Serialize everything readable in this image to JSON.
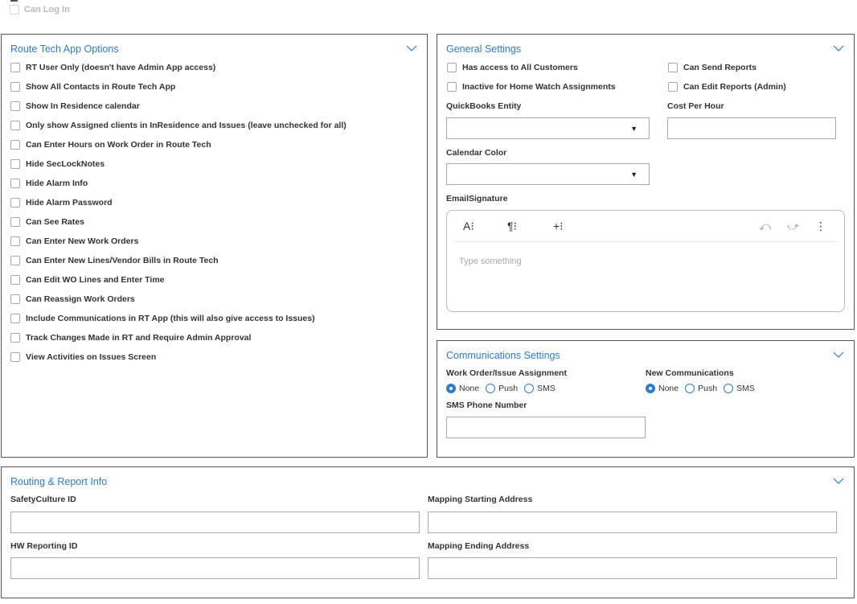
{
  "top": {
    "can_log_in": "Can Log In"
  },
  "route_tech": {
    "title": "Route Tech App Options",
    "options": [
      "RT User Only (doesn't have Admin App access)",
      "Show All Contacts in Route Tech App",
      "Show In Residence calendar",
      "Only show Assigned clients in InResidence and Issues (leave unchecked for all)",
      "Can Enter Hours on Work Order in Route Tech",
      "Hide SecLockNotes",
      "Hide Alarm Info",
      "Hide Alarm Password",
      "Can See Rates",
      "Can Enter New Work Orders",
      "Can Enter New Lines/Vendor Bills in Route Tech",
      "Can Edit WO Lines and Enter Time",
      "Can Reassign Work Orders",
      "Include Communications in RT App (this will also give access to Issues)",
      "Track Changes Made in RT and Require Admin Approval",
      "View Activities on Issues Screen"
    ]
  },
  "general": {
    "title": "General Settings",
    "has_access_all_customers": "Has access to All Customers",
    "inactive_home_watch": "Inactive for Home Watch Assignments",
    "can_send_reports": "Can Send Reports",
    "can_edit_reports": "Can Edit Reports (Admin)",
    "quickbooks_label": "QuickBooks Entity",
    "quickbooks_value": "",
    "cost_per_hour_label": "Cost Per Hour",
    "cost_per_hour_value": "",
    "calendar_color_label": "Calendar Color",
    "calendar_color_value": "",
    "email_signature_label": "EmailSignature",
    "editor": {
      "font_btn": "A⁝",
      "para_btn": "¶⁝",
      "insert_btn": "+⁝",
      "undo": "⤺",
      "redo": "⤻",
      "more": "⋮",
      "placeholder": "Type something"
    }
  },
  "communications": {
    "title": "Communications Settings",
    "work_order_label": "Work Order/Issue Assignment",
    "new_comm_label": "New Communications",
    "options": [
      "None",
      "Push",
      "SMS"
    ],
    "work_order_selected": "None",
    "new_comm_selected": "None",
    "sms_phone_label": "SMS Phone Number",
    "sms_phone_value": ""
  },
  "routing": {
    "title": "Routing & Report Info",
    "safetyculture_label": "SafetyCulture ID",
    "safetyculture_value": "",
    "mapping_start_label": "Mapping Starting Address",
    "mapping_start_value": "",
    "hw_reporting_label": "HW Reporting ID",
    "hw_reporting_value": "",
    "mapping_end_label": "Mapping Ending Address",
    "mapping_end_value": ""
  },
  "colors": {
    "accent": "#2b7cd3",
    "border": "#555555"
  }
}
